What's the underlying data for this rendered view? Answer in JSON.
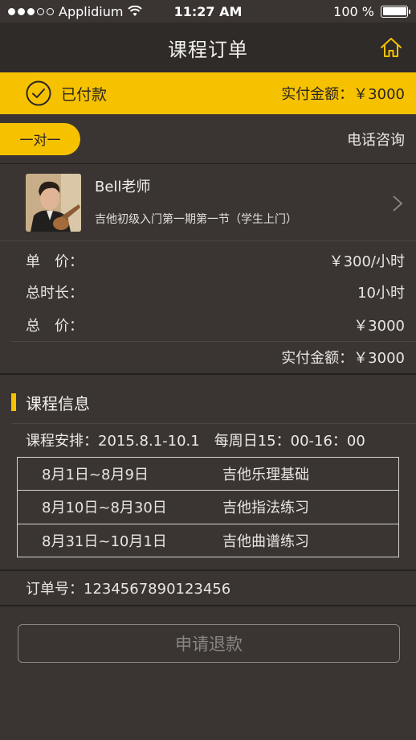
{
  "status_bar": {
    "carrier": "Applidium",
    "time": "11:27 AM",
    "battery": "100 %"
  },
  "nav": {
    "title": "课程订单",
    "home_icon": "home-icon"
  },
  "banner": {
    "status": "已付款",
    "amount": "实付金额：￥3000",
    "accent_color": "#f6c200"
  },
  "type_row": {
    "type_label": "一对一",
    "phone_consult": "电话咨询"
  },
  "teacher": {
    "name": "Bell老师",
    "course": "吉他初级入门第一期第一节（学生上门）"
  },
  "pricing": {
    "unit_price_label": "单　价：",
    "unit_price_value": "￥300/小时",
    "duration_label": "总时长：",
    "duration_value": "10小时",
    "total_label": "总　价：",
    "total_value": "￥3000",
    "paid_amount": "实付金额：￥3000"
  },
  "course_info": {
    "section_title": "课程信息",
    "schedule": "课程安排：2015.8.1-10.1　每周日15：00-16：00",
    "rows": [
      {
        "date": "8月1日~8月9日",
        "topic": "吉他乐理基础"
      },
      {
        "date": "8月10日~8月30日",
        "topic": "吉他指法练习"
      },
      {
        "date": "8月31日~10月1日",
        "topic": "吉他曲谱练习"
      }
    ]
  },
  "order": {
    "number": "订单号：1234567890123456"
  },
  "actions": {
    "refund_label": "申请退款"
  }
}
